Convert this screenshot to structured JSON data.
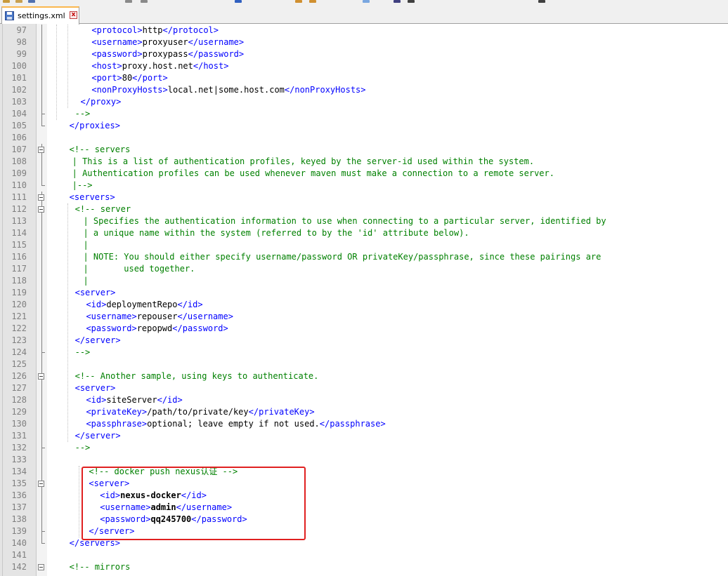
{
  "tab": {
    "filename": "settings.xml",
    "close_glyph": "x"
  },
  "icons": {
    "save": "save-icon",
    "close": "close-icon"
  },
  "colors": {
    "tag": "#0000ff",
    "comment": "#008000",
    "highlight": "#e02020",
    "line_number": "#7f7f7f"
  },
  "lines": [
    {
      "n": "97",
      "parts": [
        [
          "t",
          "<protocol>"
        ],
        [
          "x",
          "http"
        ],
        [
          "t",
          "</protocol>"
        ]
      ]
    },
    {
      "n": "98",
      "parts": [
        [
          "t",
          "<username>"
        ],
        [
          "x",
          "proxyuser"
        ],
        [
          "t",
          "</username>"
        ]
      ]
    },
    {
      "n": "99",
      "parts": [
        [
          "t",
          "<password>"
        ],
        [
          "x",
          "proxypass"
        ],
        [
          "t",
          "</password>"
        ]
      ]
    },
    {
      "n": "100",
      "parts": [
        [
          "t",
          "<host>"
        ],
        [
          "x",
          "proxy.host.net"
        ],
        [
          "t",
          "</host>"
        ]
      ]
    },
    {
      "n": "101",
      "parts": [
        [
          "t",
          "<port>"
        ],
        [
          "x",
          "80"
        ],
        [
          "t",
          "</port>"
        ]
      ]
    },
    {
      "n": "102",
      "parts": [
        [
          "t",
          "<nonProxyHosts>"
        ],
        [
          "x",
          "local.net|some.host.com"
        ],
        [
          "t",
          "</nonProxyHosts>"
        ]
      ]
    },
    {
      "n": "103",
      "parts": [
        [
          "t",
          "</proxy>"
        ]
      ]
    },
    {
      "n": "104",
      "parts": [
        [
          "c",
          "-->"
        ]
      ]
    },
    {
      "n": "105",
      "parts": [
        [
          "t",
          "</proxies>"
        ]
      ]
    },
    {
      "n": "106",
      "parts": []
    },
    {
      "n": "107",
      "parts": [
        [
          "c",
          "<!-- servers"
        ]
      ]
    },
    {
      "n": "108",
      "parts": [
        [
          "c",
          "| This is a list of authentication profiles, keyed by the server-id used within the system."
        ]
      ]
    },
    {
      "n": "109",
      "parts": [
        [
          "c",
          "| Authentication profiles can be used whenever maven must make a connection to a remote server."
        ]
      ]
    },
    {
      "n": "110",
      "parts": [
        [
          "c",
          "|-->"
        ]
      ]
    },
    {
      "n": "111",
      "parts": [
        [
          "t",
          "<servers>"
        ]
      ]
    },
    {
      "n": "112",
      "parts": [
        [
          "c",
          "<!-- server"
        ]
      ]
    },
    {
      "n": "113",
      "parts": [
        [
          "c",
          "| Specifies the authentication information to use when connecting to a particular server, identified by"
        ]
      ]
    },
    {
      "n": "114",
      "parts": [
        [
          "c",
          "| a unique name within the system (referred to by the 'id' attribute below)."
        ]
      ]
    },
    {
      "n": "115",
      "parts": [
        [
          "c",
          "|"
        ]
      ]
    },
    {
      "n": "116",
      "parts": [
        [
          "c",
          "| NOTE: You should either specify username/password OR privateKey/passphrase, since these pairings are"
        ]
      ]
    },
    {
      "n": "117",
      "parts": [
        [
          "c",
          "|       used together."
        ]
      ]
    },
    {
      "n": "118",
      "parts": [
        [
          "c",
          "|"
        ]
      ]
    },
    {
      "n": "119",
      "parts": [
        [
          "t",
          "<server>"
        ]
      ]
    },
    {
      "n": "120",
      "parts": [
        [
          "t",
          "<id>"
        ],
        [
          "x",
          "deploymentRepo"
        ],
        [
          "t",
          "</id>"
        ]
      ]
    },
    {
      "n": "121",
      "parts": [
        [
          "t",
          "<username>"
        ],
        [
          "x",
          "repouser"
        ],
        [
          "t",
          "</username>"
        ]
      ]
    },
    {
      "n": "122",
      "parts": [
        [
          "t",
          "<password>"
        ],
        [
          "x",
          "repopwd"
        ],
        [
          "t",
          "</password>"
        ]
      ]
    },
    {
      "n": "123",
      "parts": [
        [
          "t",
          "</server>"
        ]
      ]
    },
    {
      "n": "124",
      "parts": [
        [
          "c",
          "-->"
        ]
      ]
    },
    {
      "n": "125",
      "parts": []
    },
    {
      "n": "126",
      "parts": [
        [
          "c",
          "<!-- Another sample, using keys to authenticate."
        ]
      ]
    },
    {
      "n": "127",
      "parts": [
        [
          "t",
          "<server>"
        ]
      ]
    },
    {
      "n": "128",
      "parts": [
        [
          "t",
          "<id>"
        ],
        [
          "x",
          "siteServer"
        ],
        [
          "t",
          "</id>"
        ]
      ]
    },
    {
      "n": "129",
      "parts": [
        [
          "t",
          "<privateKey>"
        ],
        [
          "x",
          "/path/to/private/key"
        ],
        [
          "t",
          "</privateKey>"
        ]
      ]
    },
    {
      "n": "130",
      "parts": [
        [
          "t",
          "<passphrase>"
        ],
        [
          "x",
          "optional; leave empty if not used."
        ],
        [
          "t",
          "</passphrase>"
        ]
      ]
    },
    {
      "n": "131",
      "parts": [
        [
          "t",
          "</server>"
        ]
      ]
    },
    {
      "n": "132",
      "parts": [
        [
          "c",
          "-->"
        ]
      ]
    },
    {
      "n": "133",
      "parts": []
    },
    {
      "n": "134",
      "parts": [
        [
          "c",
          "<!-- docker push nexus认证 -->"
        ]
      ]
    },
    {
      "n": "135",
      "parts": [
        [
          "t",
          "<server>"
        ]
      ]
    },
    {
      "n": "136",
      "parts": [
        [
          "t",
          "<id>"
        ],
        [
          "b",
          "nexus-docker"
        ],
        [
          "t",
          "</id>"
        ]
      ]
    },
    {
      "n": "137",
      "parts": [
        [
          "t",
          "<username>"
        ],
        [
          "b",
          "admin"
        ],
        [
          "t",
          "</username>"
        ]
      ]
    },
    {
      "n": "138",
      "parts": [
        [
          "t",
          "<password>"
        ],
        [
          "b",
          "qq245700"
        ],
        [
          "t",
          "</password>"
        ]
      ]
    },
    {
      "n": "139",
      "parts": [
        [
          "t",
          "</server>"
        ]
      ]
    },
    {
      "n": "140",
      "parts": [
        [
          "t",
          "</servers>"
        ]
      ]
    },
    {
      "n": "141",
      "parts": []
    },
    {
      "n": "142",
      "parts": [
        [
          "c",
          "<!-- mirrors"
        ]
      ]
    }
  ]
}
